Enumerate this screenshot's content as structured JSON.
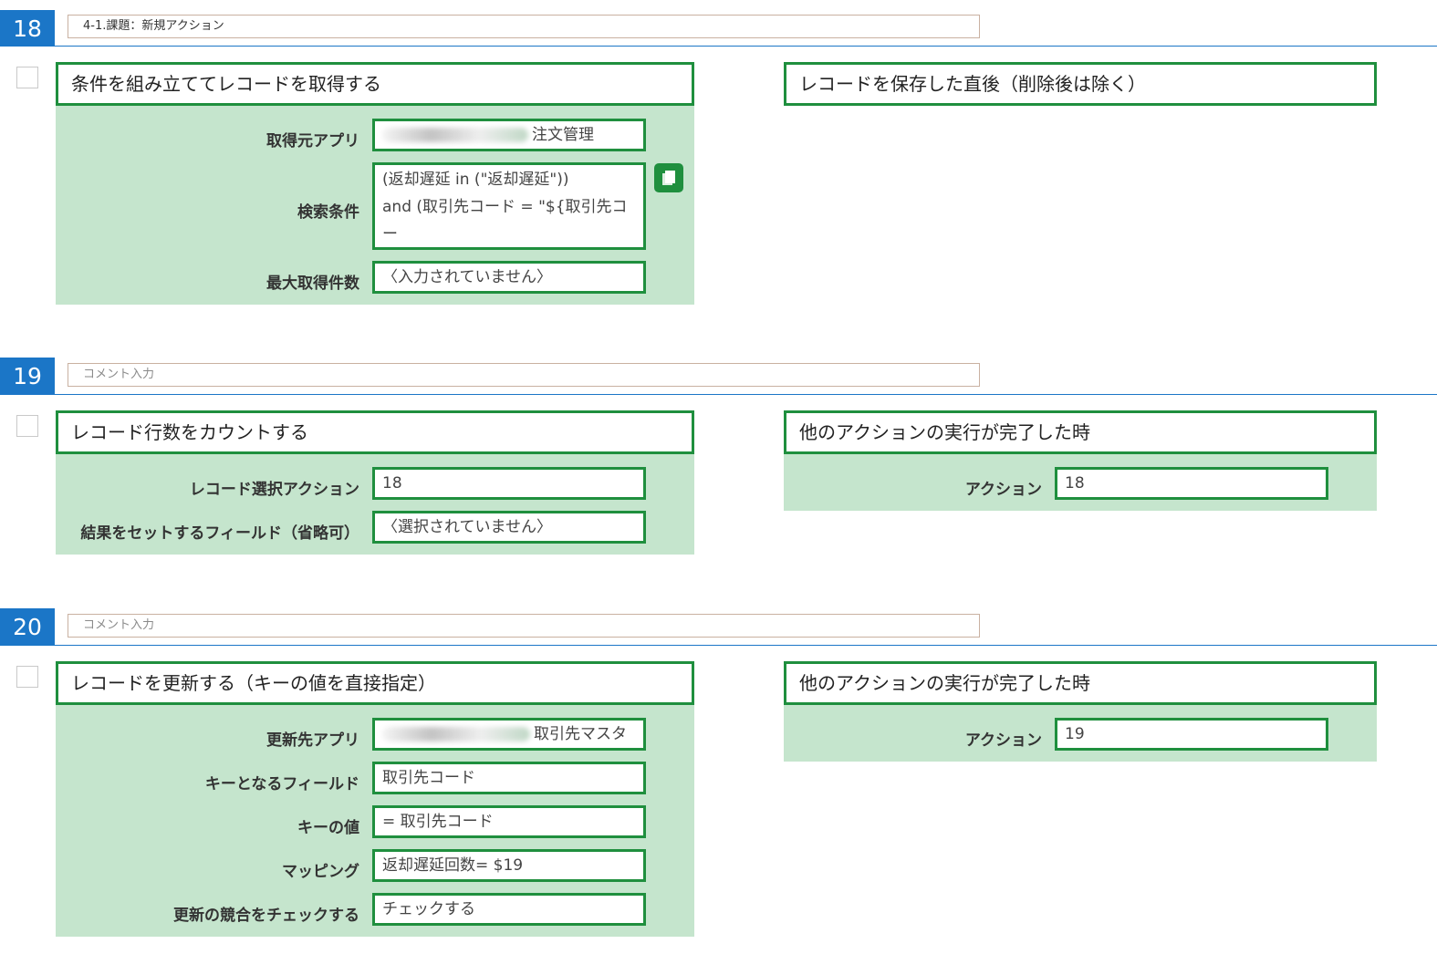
{
  "actions": [
    {
      "number": "18",
      "comment": "4-1.課題：新規アクション",
      "action_title": "条件を組み立ててレコードを取得する",
      "fields": [
        {
          "label": "取得元アプリ",
          "value": "注文管理"
        },
        {
          "label": "検索条件",
          "value": "(返却遅延 in (\"返却遅延\"))\nand (取引先コード = \"${取引先コード}\")"
        },
        {
          "label": "最大取得件数",
          "value": "〈入力されていません〉"
        }
      ],
      "trigger_title": "レコードを保存した直後（削除後は除く）"
    },
    {
      "number": "19",
      "comment": "コメント入力",
      "action_title": "レコード行数をカウントする",
      "fields": [
        {
          "label": "レコード選択アクション",
          "value": "18"
        },
        {
          "label": "結果をセットするフィールド（省略可）",
          "value": "〈選択されていません〉"
        }
      ],
      "trigger_title": "他のアクションの実行が完了した時",
      "trigger_field": {
        "label": "アクション",
        "value": "18"
      }
    },
    {
      "number": "20",
      "comment": "コメント入力",
      "action_title": "レコードを更新する（キーの値を直接指定）",
      "fields": [
        {
          "label": "更新先アプリ",
          "value": "取引先マスタ"
        },
        {
          "label": "キーとなるフィールド",
          "value": "取引先コード"
        },
        {
          "label": "キーの値",
          "value": "= 取引先コード"
        },
        {
          "label": "マッピング",
          "value": "返却遅延回数= $19"
        },
        {
          "label": "更新の競合をチェックする",
          "value": "チェックする"
        }
      ],
      "trigger_title": "他のアクションの実行が完了した時",
      "trigger_field": {
        "label": "アクション",
        "value": "19"
      }
    }
  ],
  "colors": {
    "accent_blue": "#1b76c7",
    "green_border": "#1f8f3e",
    "pane_green": "#c5e5cd"
  },
  "icons": {
    "copy": "copy-icon"
  }
}
